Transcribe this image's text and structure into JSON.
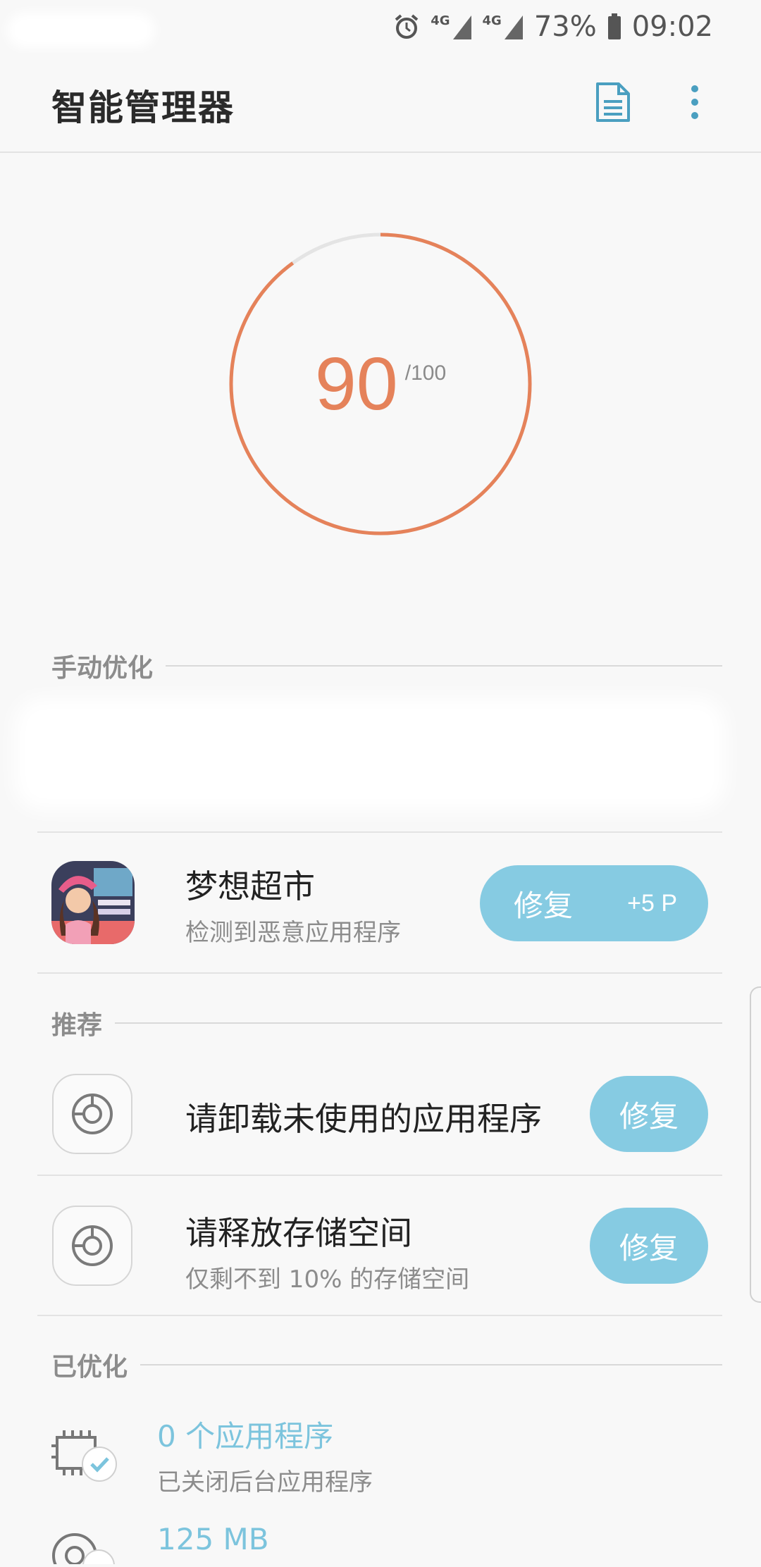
{
  "status_bar": {
    "network_1": "4G",
    "network_2": "4G",
    "battery": "73%",
    "time": "09:02"
  },
  "app_bar": {
    "title": "智能管理器",
    "report_icon": "document-icon",
    "more_icon": "more-vert-icon"
  },
  "score": {
    "value": "90",
    "max": "/100",
    "fraction": 0.9,
    "color": "#e5825a"
  },
  "manual": {
    "header": "手动优化",
    "item": {
      "name": "梦想超市",
      "subtitle": "检测到恶意应用程序",
      "button_label": "修复",
      "button_points": "+5 P"
    }
  },
  "recommend": {
    "header": "推荐",
    "items": [
      {
        "title": "请卸载未使用的应用程序",
        "subtitle": "",
        "button_label": "修复"
      },
      {
        "title": "请释放存储空间",
        "subtitle": "仅剩不到 10% 的存储空间",
        "button_label": "修复"
      }
    ]
  },
  "optimized": {
    "header": "已优化",
    "items": [
      {
        "title": "0 个应用程序",
        "subtitle": "已关闭后台应用程序"
      },
      {
        "title": "125 MB",
        "subtitle": ""
      }
    ]
  },
  "colors": {
    "accent": "#86cbe2",
    "score": "#e5825a"
  }
}
